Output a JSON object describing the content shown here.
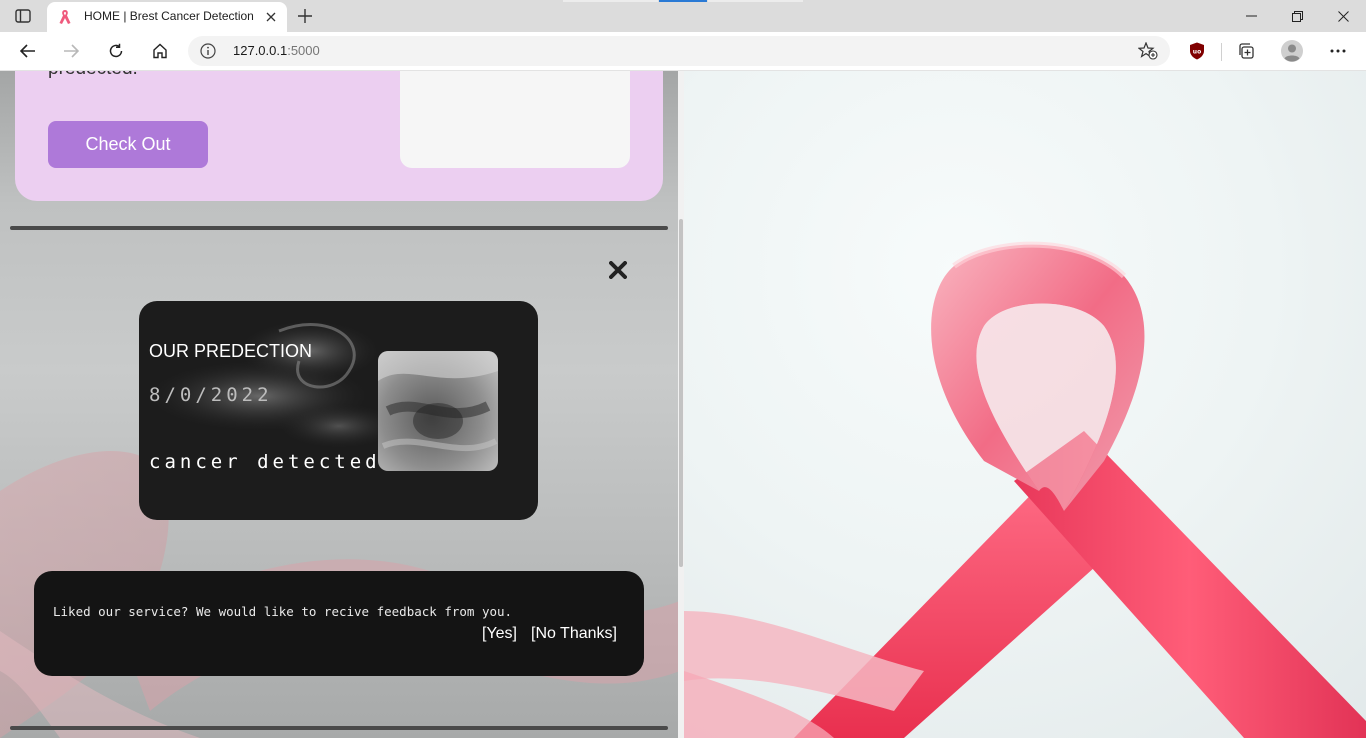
{
  "browser": {
    "tab": {
      "title": "HOME | Brest Cancer Detection",
      "favicon": "pink-ribbon-icon",
      "close": "close-icon"
    },
    "address": {
      "host": "127.0.0.1",
      "port": ":5000"
    },
    "colors": {
      "tab_strip": "#dcdcdc",
      "toolbar": "#ffffff",
      "address_bar": "#f3f3f3"
    }
  },
  "page": {
    "info_card": {
      "text": "predected.",
      "button": "Check Out"
    },
    "prediction": {
      "title": "OUR PREDECTION",
      "date": "8/0/2022",
      "result": "cancer detected"
    },
    "feedback": {
      "message": "Liked our service? We would like to recive feedback from you.",
      "yes": "[Yes]",
      "no": "[No Thanks]"
    },
    "colors": {
      "accent_purple": "#ae79d9",
      "card_pink": "#eccff1",
      "dark_card": "#1c1c1c",
      "ribbon_pink": "#f03a5f"
    }
  }
}
